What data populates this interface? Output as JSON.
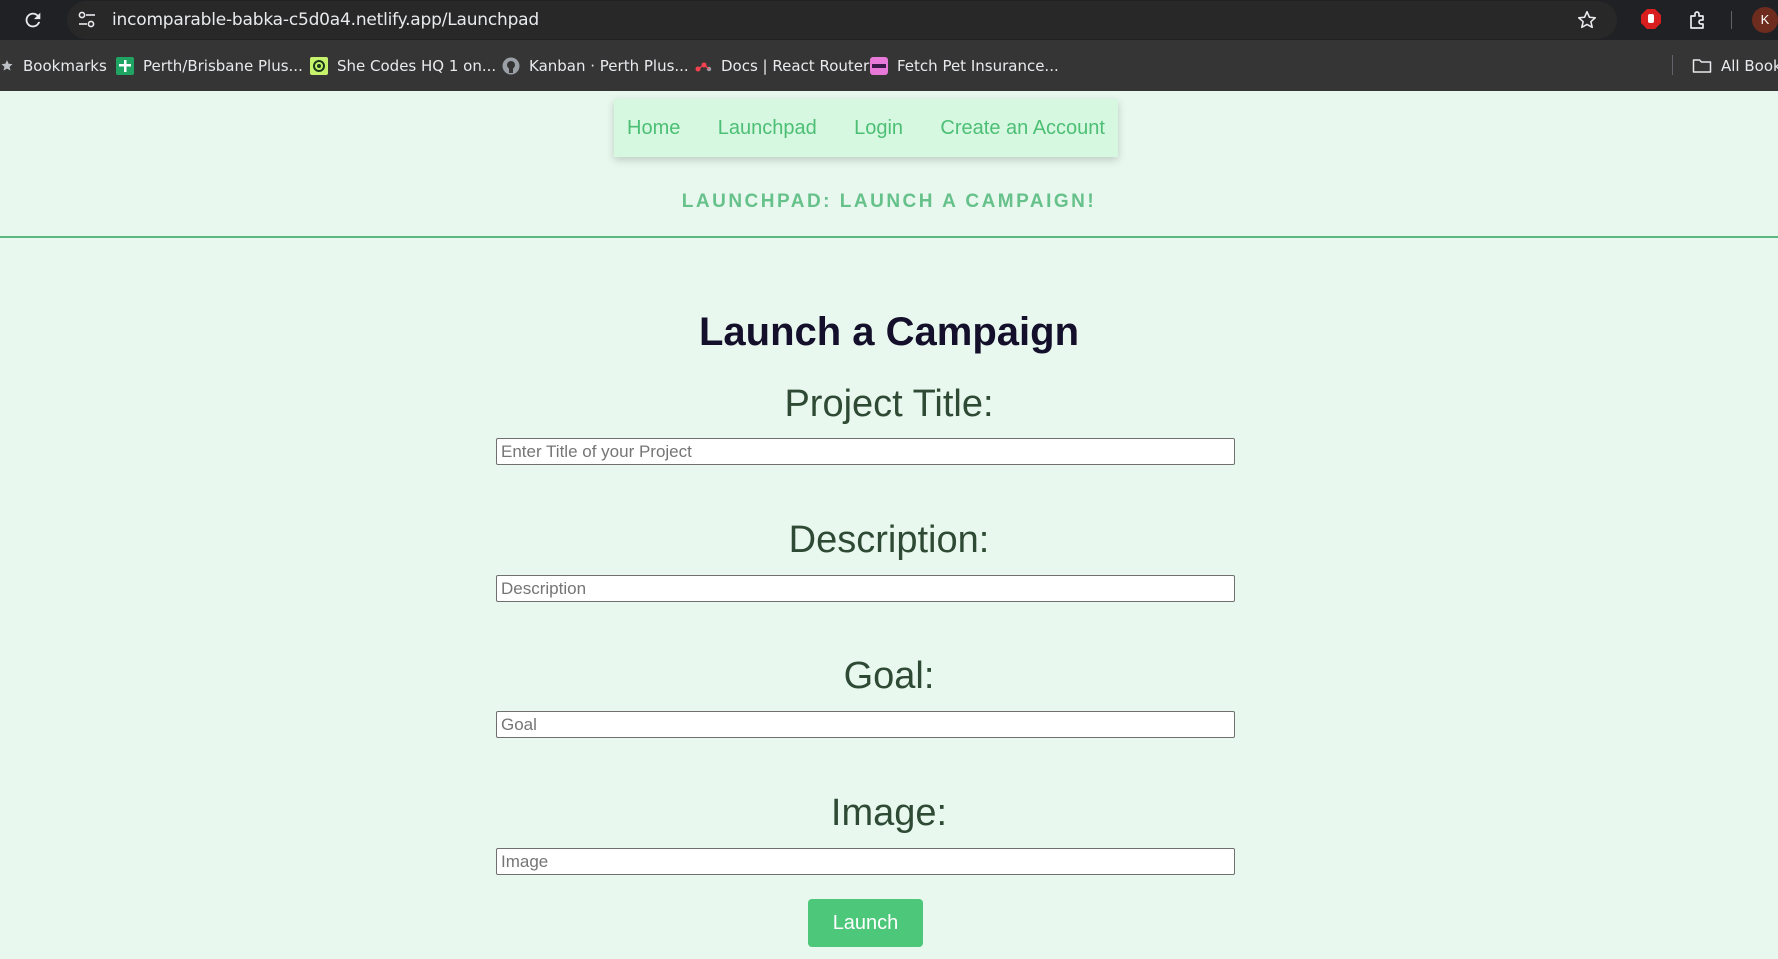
{
  "browser": {
    "url": "incomparable-babka-c5d0a4.netlify.app/Launchpad",
    "profile_initial": "K",
    "bookmarks": [
      {
        "label": "Bookmarks",
        "icon": "star-icon"
      },
      {
        "label": "Perth/Brisbane Plus...",
        "icon": "green-plus-icon"
      },
      {
        "label": "She Codes HQ 1 on...",
        "icon": "she-codes-icon"
      },
      {
        "label": "Kanban · Perth Plus...",
        "icon": "github-icon"
      },
      {
        "label": "Docs | React Router",
        "icon": "react-router-icon"
      },
      {
        "label": "Fetch Pet Insurance...",
        "icon": "fetch-icon"
      }
    ],
    "all_bookmarks": "All Book"
  },
  "nav": {
    "home": "Home",
    "launchpad": "Launchpad",
    "login": "Login",
    "create_account": "Create an Account"
  },
  "banner": "LAUNCHPAD: LAUNCH A CAMPAIGN!",
  "form": {
    "title": "Launch a Campaign",
    "fields": [
      {
        "label": "Project Title:",
        "placeholder": "Enter Title of your Project",
        "value": ""
      },
      {
        "label": "Description:",
        "placeholder": "Description",
        "value": ""
      },
      {
        "label": "Goal:",
        "placeholder": "Goal",
        "value": ""
      },
      {
        "label": "Image:",
        "placeholder": "Image",
        "value": ""
      }
    ],
    "submit_label": "Launch"
  },
  "colors": {
    "page_bg": "#e8f8ee",
    "nav_bg": "#d6f8e0",
    "accent": "#4dc77a",
    "link": "#4cbf75",
    "title": "#14102b"
  }
}
